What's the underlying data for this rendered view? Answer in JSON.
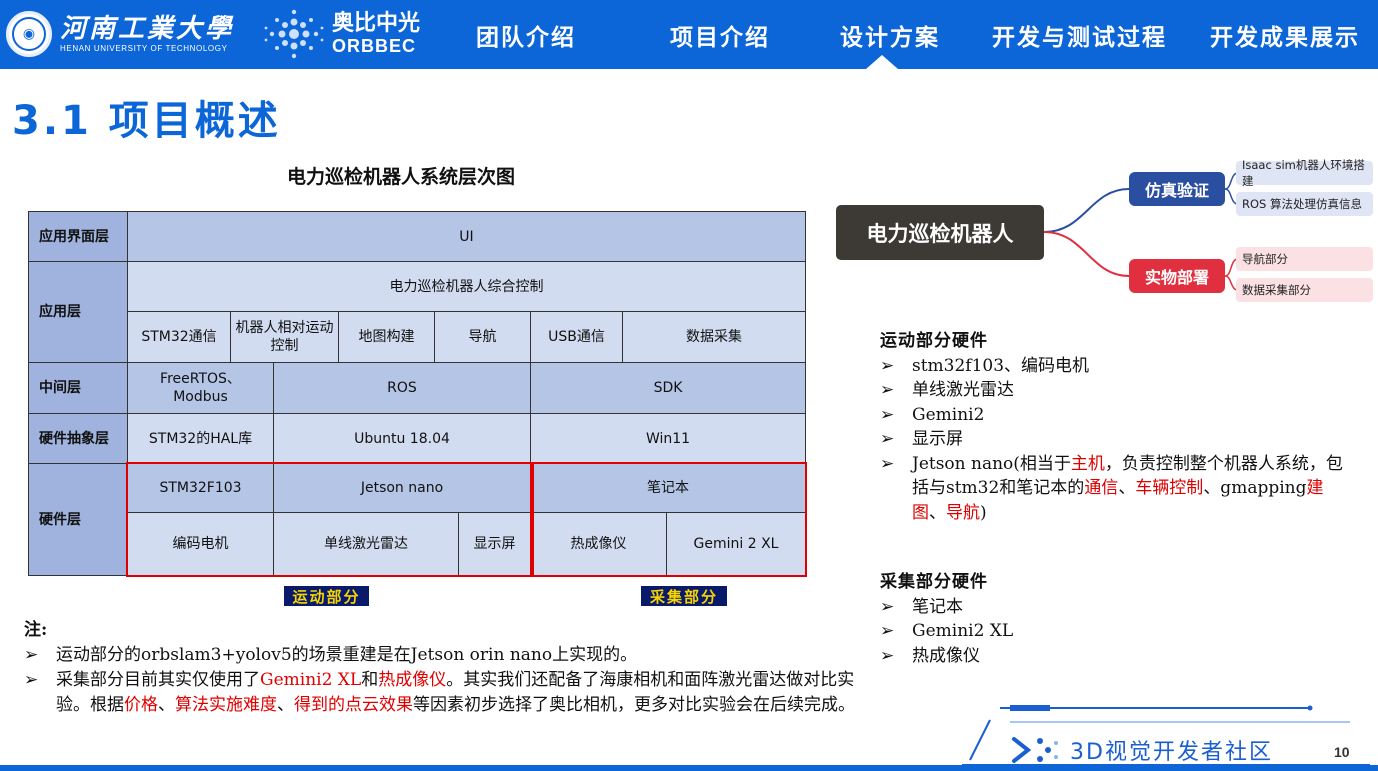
{
  "header": {
    "university_cn": "河南工業大學",
    "university_en": "HENAN UNIVERSITY OF TECHNOLOGY",
    "partner_cn": "奥比中光",
    "partner_en": "ORBBEC",
    "nav": [
      "团队介绍",
      "项目介绍",
      "设计方案",
      "开发与测试过程",
      "开发成果展示"
    ],
    "active_nav": "设计方案"
  },
  "page_title": "3.1 项目概述",
  "diagram": {
    "title": "电力巡检机器人系统层次图",
    "layers": {
      "app_ui": "应用界面层",
      "app": "应用层",
      "middle": "中间层",
      "hal": "硬件抽象层",
      "hw": "硬件层"
    },
    "ui": "UI",
    "control": "电力巡检机器人综合控制",
    "app_items": [
      "STM32通信",
      "机器人相对运动控制",
      "地图构建",
      "导航",
      "USB通信",
      "数据采集"
    ],
    "middle_items": [
      "FreeRTOS、Modbus",
      "ROS",
      "SDK"
    ],
    "hal_items": [
      "STM32的HAL库",
      "Ubuntu 18.04",
      "Win11"
    ],
    "hw_top": [
      "STM32F103",
      "Jetson nano",
      "笔记本"
    ],
    "hw_bottom": [
      "编码电机",
      "单线激光雷达",
      "显示屏",
      "热成像仪",
      "Gemini 2 XL"
    ],
    "tags": [
      "运动部分",
      "采集部分"
    ]
  },
  "notes": {
    "label": "注:",
    "line1": "运动部分的orbslam3+yolov5的场景重建是在Jetson orin nano上实现的。",
    "line2_a": "采集部分目前其实仅使用了",
    "line2_r1": "Gemini2 XL",
    "line2_b": "和",
    "line2_r2": "热成像仪",
    "line2_c": "。其实我们还配备了海康相机和面阵激光雷达做对比实验。根据",
    "line2_r3": "价格",
    "line2_d": "、",
    "line2_r4": "算法实施难度",
    "line2_e": "、",
    "line2_r5": "得到的点云效果",
    "line2_f": "等因素初步选择了奥比相机，更多对比实验会在后续完成。",
    "bullet": "➢"
  },
  "mindmap": {
    "root": "电力巡检机器人",
    "branch1": "仿真验证",
    "branch1_leaves": [
      "Isaac sim机器人环境搭建",
      "ROS 算法处理仿真信息"
    ],
    "branch2": "实物部署",
    "branch2_leaves": [
      "导航部分",
      "数据采集部分"
    ],
    "colors": {
      "root": "#3d3935",
      "branch1": "#2b4fa0",
      "branch2": "#e03040"
    }
  },
  "motion_hw": {
    "title": "运动部分硬件",
    "items": [
      "stm32f103、编码电机",
      "单线激光雷达",
      "Gemini2",
      "显示屏"
    ],
    "jetson_a": "Jetson nano(相当于",
    "jetson_r1": "主机",
    "jetson_b": "，负责控制整个机器人系统，包括与stm32和笔记本的",
    "jetson_r2": "通信",
    "jetson_c": "、",
    "jetson_r3": "车辆控制",
    "jetson_d": "、gmapping",
    "jetson_r4": "建图",
    "jetson_e": "、",
    "jetson_r5": "导航",
    "jetson_f": ")"
  },
  "collect_hw": {
    "title": "采集部分硬件",
    "items": [
      "笔记本",
      "Gemini2 XL",
      "热成像仪"
    ]
  },
  "footer": {
    "brand": "3D视觉开发者社区",
    "page": "10"
  },
  "colors": {
    "primary": "#0c66d8",
    "highlight": "#e00000"
  }
}
